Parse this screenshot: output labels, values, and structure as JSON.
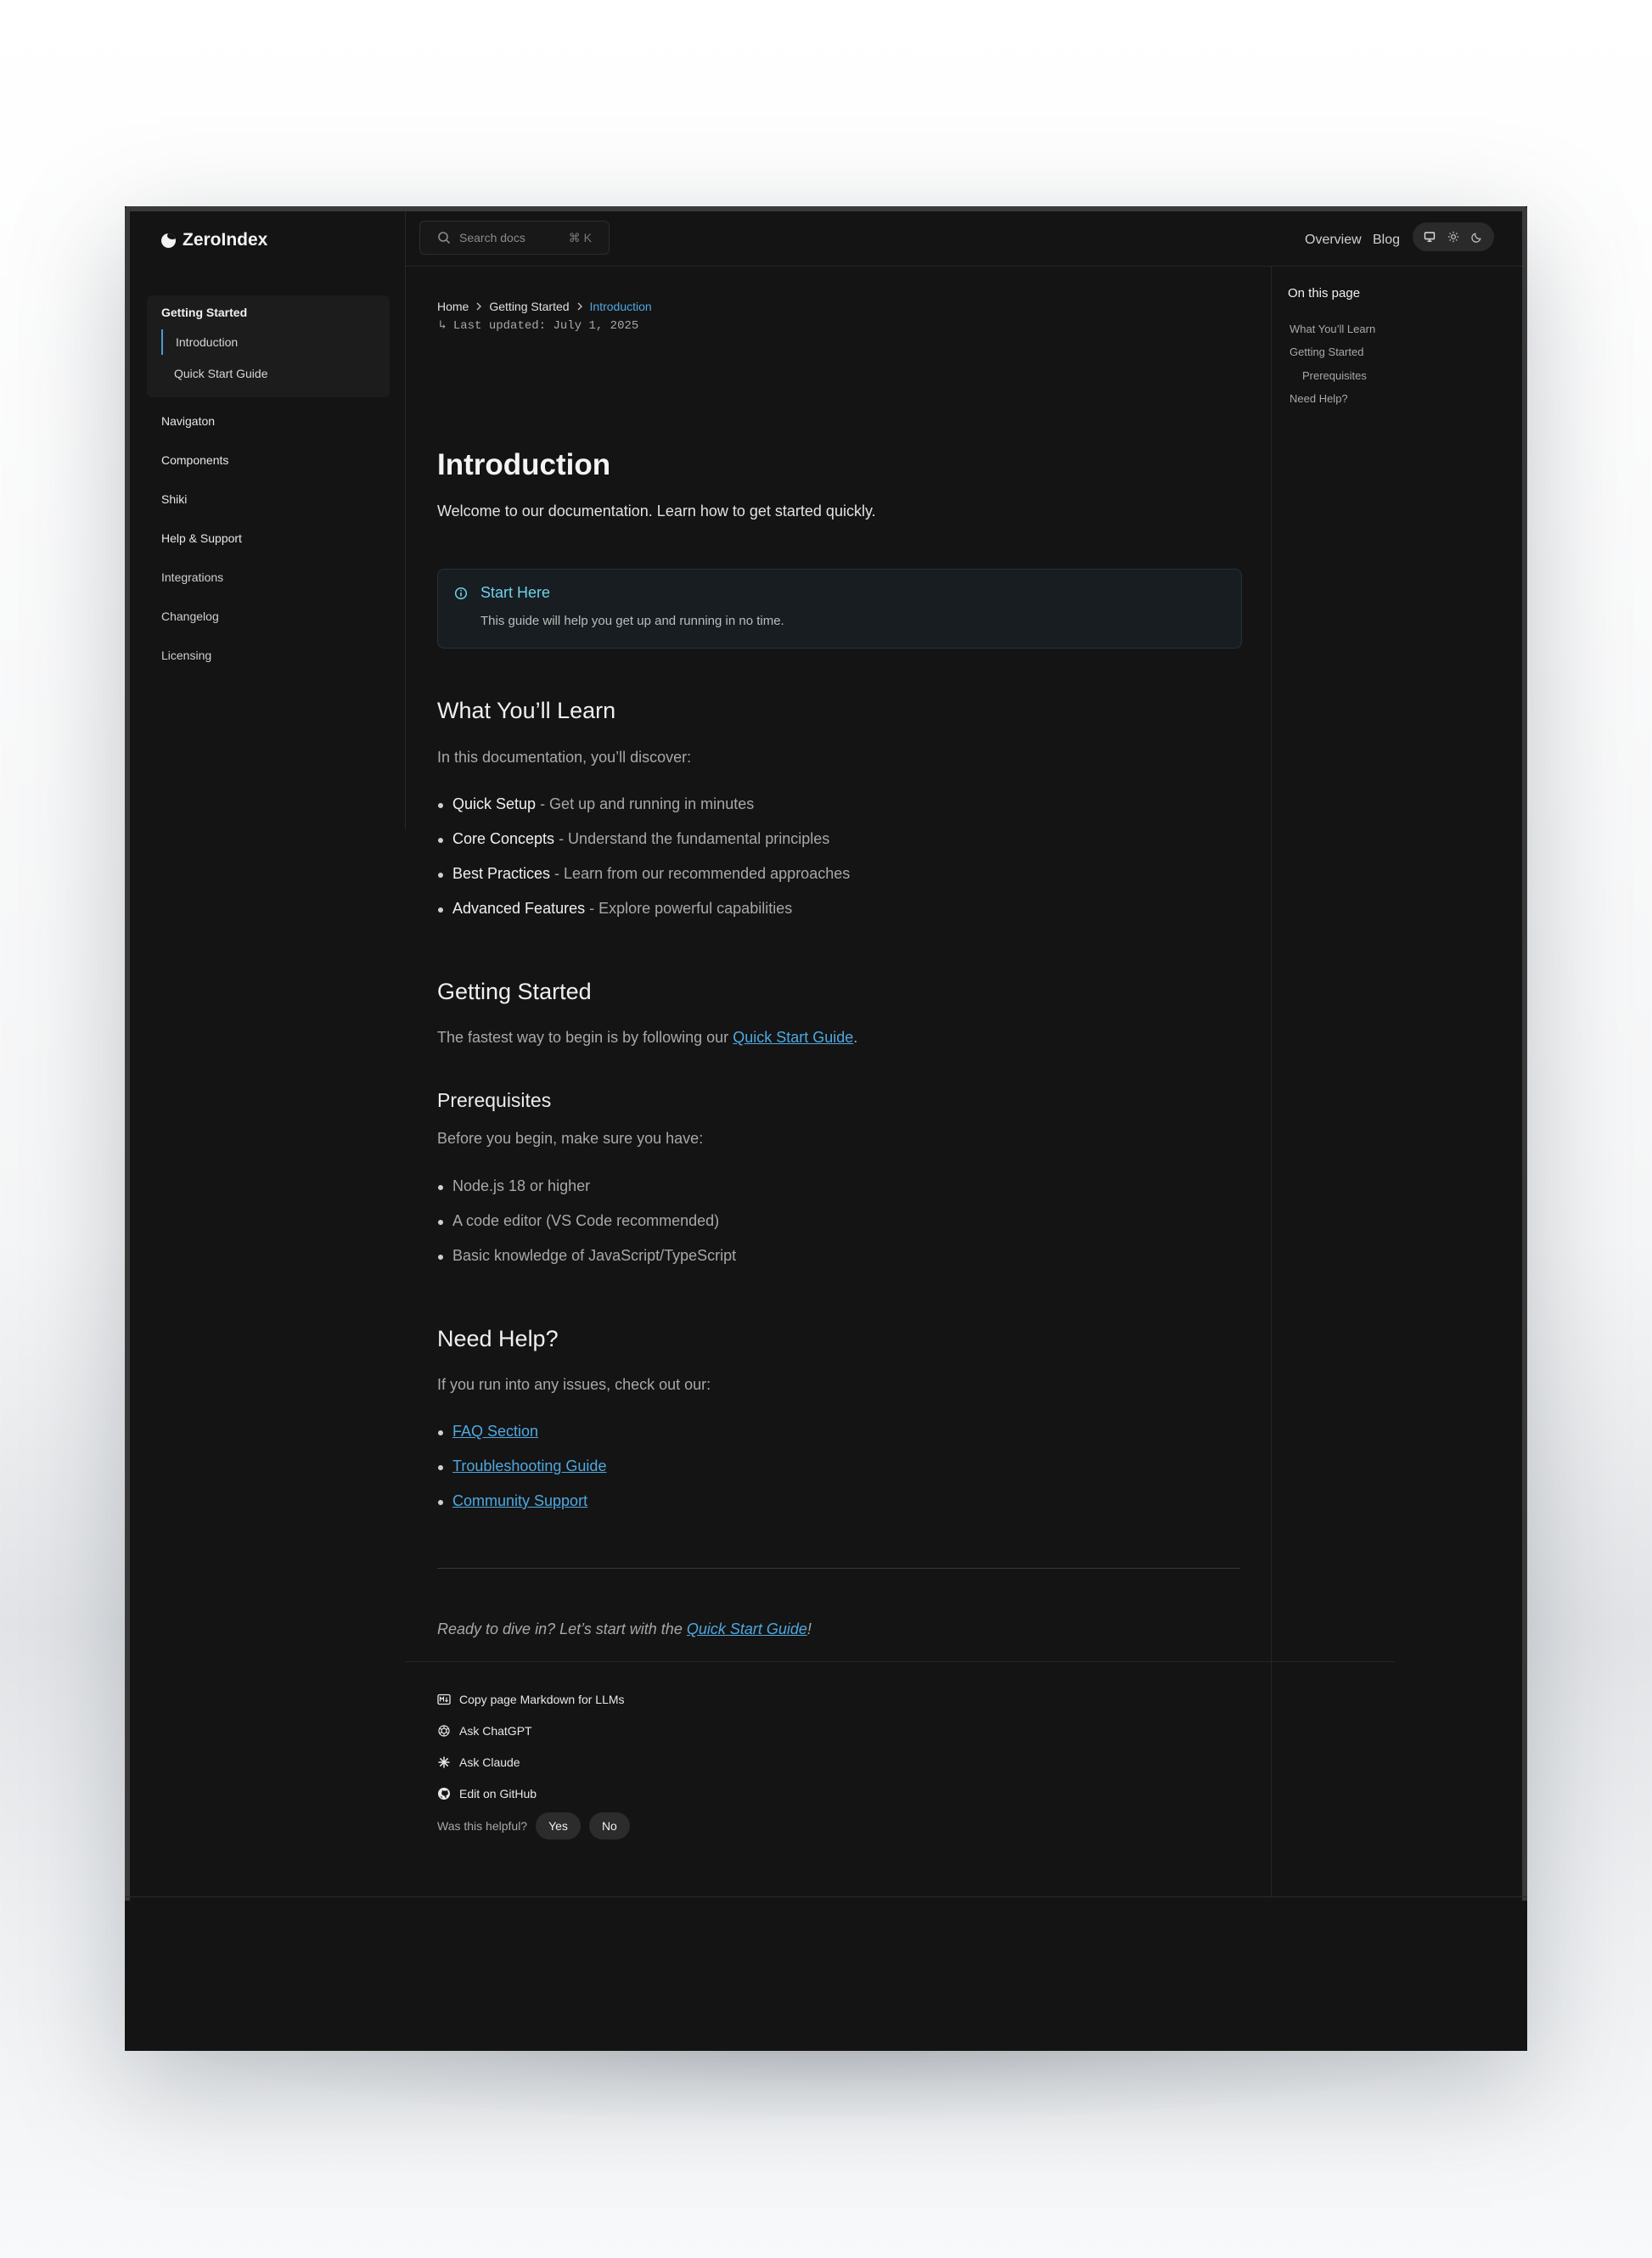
{
  "brand": {
    "name": "ZeroIndex"
  },
  "search": {
    "placeholder": "Search docs",
    "shortcut": "⌘ K"
  },
  "header": {
    "links": [
      "Overview",
      "Blog"
    ],
    "theme_modes": [
      "monitor-icon",
      "sun-icon",
      "moon-icon"
    ]
  },
  "sidebar": {
    "group": {
      "label": "Getting Started",
      "children": [
        "Introduction",
        "Quick Start Guide"
      ]
    },
    "items": [
      "Navigaton",
      "Components",
      "Shiki",
      "Help & Support",
      "Integrations",
      "Changelog",
      "Licensing"
    ]
  },
  "breadcrumb": {
    "items": [
      "Home",
      "Getting Started",
      "Introduction"
    ]
  },
  "meta": {
    "last_updated": "Last updated: July 1, 2025"
  },
  "page": {
    "title": "Introduction",
    "lead": "Welcome to our documentation. Learn how to get started quickly.",
    "callout": {
      "title": "Start Here",
      "body": "This guide will help you get up and running in no time."
    },
    "learn": {
      "heading": "What You’ll Learn",
      "intro": "In this documentation, you’ll discover:",
      "items": [
        {
          "term": "Quick Setup",
          "desc": " - Get up and running in minutes"
        },
        {
          "term": "Core Concepts",
          "desc": " - Understand the fundamental principles"
        },
        {
          "term": "Best Practices",
          "desc": " - Learn from our recommended approaches"
        },
        {
          "term": "Advanced Features",
          "desc": " - Explore powerful capabilities"
        }
      ]
    },
    "getting_started": {
      "heading": "Getting Started",
      "text_before": "The fastest way to begin is by following our ",
      "link": "Quick Start Guide",
      "text_after": "."
    },
    "prereq": {
      "heading": "Prerequisites",
      "intro": "Before you begin, make sure you have:",
      "items": [
        "Node.js 18 or higher",
        "A code editor (VS Code recommended)",
        "Basic knowledge of JavaScript/TypeScript"
      ]
    },
    "help": {
      "heading": "Need Help?",
      "intro": "If you run into any issues, check out our:",
      "links": [
        "FAQ Section",
        "Troubleshooting Guide",
        "Community Support"
      ]
    },
    "closing": {
      "text_before": "Ready to dive in? Let’s start with the ",
      "link": "Quick Start Guide",
      "text_after": "!"
    }
  },
  "actions": [
    "Copy page Markdown for LLMs",
    "Ask ChatGPT",
    "Ask Claude",
    "Edit on GitHub"
  ],
  "feedback": {
    "question": "Was this helpful?",
    "yes": "Yes",
    "no": "No"
  },
  "toc": {
    "title": "On this page",
    "items": [
      "What You’ll Learn",
      "Getting Started",
      "Prerequisites",
      "Need Help?"
    ]
  },
  "colors": {
    "background": "#141414",
    "accent": "#4fa8e0",
    "callout_title": "#6fd0e8"
  }
}
